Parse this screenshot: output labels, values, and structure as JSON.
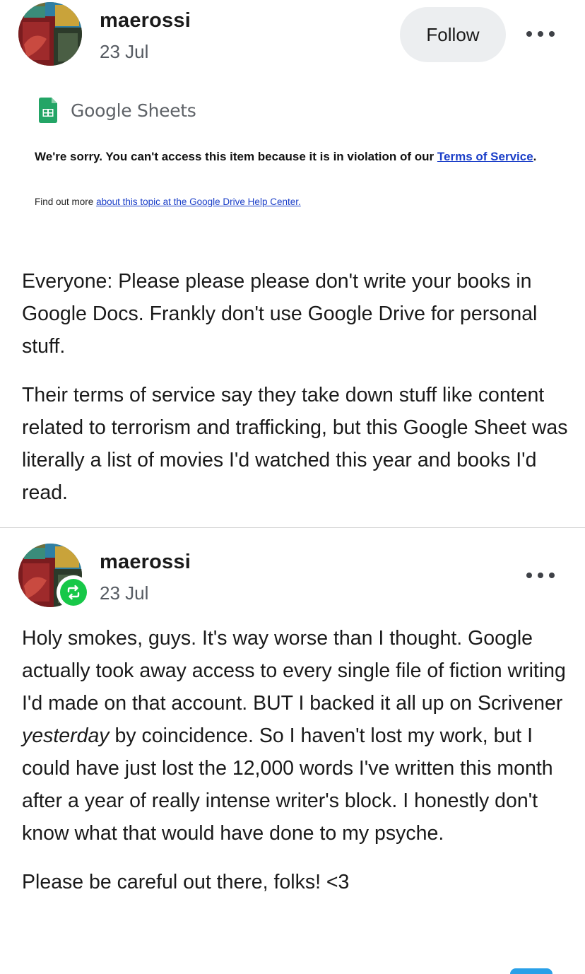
{
  "post1": {
    "username": "maerossi",
    "date": "23 Jul",
    "follow_label": "Follow",
    "embed": {
      "product_name": "Google Sheets",
      "sorry_text": "We're sorry. You can't access this item because it is in violation of our",
      "tos_link": "Terms of Service",
      "tos_after": ".",
      "findout_prefix": "Find out more",
      "findout_link": "about this topic at the Google Drive Help Center."
    },
    "paragraphs": [
      "Everyone: Please please please don't write your books in Google Docs. Frankly don't use Google Drive for personal stuff.",
      "Their terms of service say they take down stuff like content related to terrorism and trafficking, but this Google Sheet was literally a list of movies I'd watched this year and books I'd read."
    ]
  },
  "post2": {
    "username": "maerossi",
    "date": "23 Jul",
    "para1_before": "Holy smokes, guys. It's way worse than I thought. Google actually took away access to every single file of fiction writing I'd made on that account. BUT I backed it all up on Scrivener ",
    "para1_emphasis": "yesterday",
    "para1_after": " by coincidence. So I haven't lost my work, but I could have just lost the 12,000 words I've written this month after a year of really intense writer's block. I honestly don't know what that would have done to my psyche.",
    "para2": "Please be careful out there, folks! <3"
  },
  "colors": {
    "reblog_green": "#17c848",
    "link_blue": "#1a3ec8",
    "sheets_green": "#23a566"
  },
  "icons": {
    "more": "more-horizontal-icon",
    "reblog": "reblog-icon",
    "sheets": "google-sheets-icon"
  }
}
